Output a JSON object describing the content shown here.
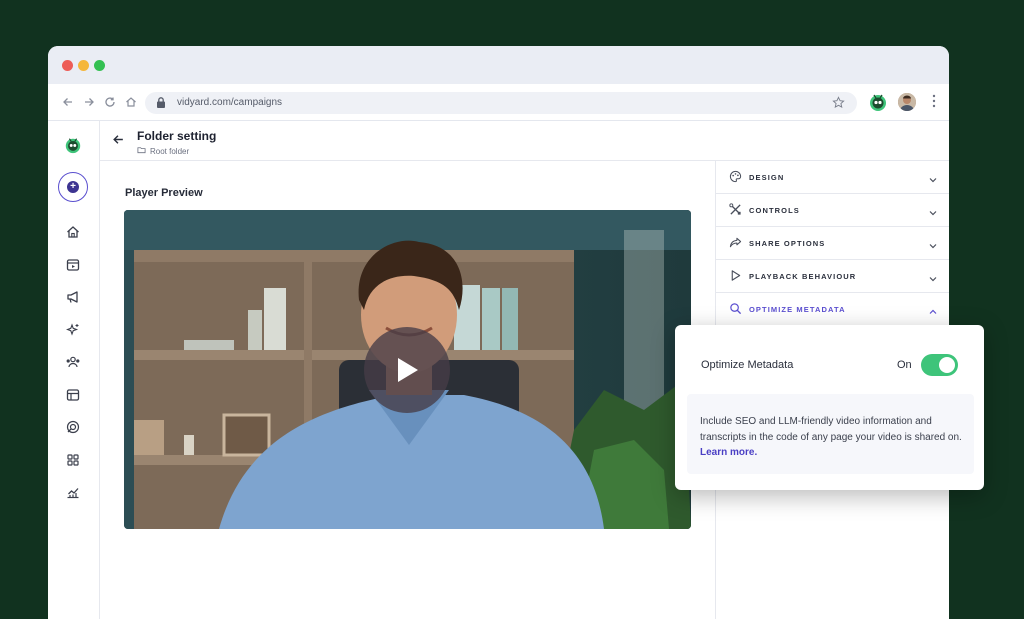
{
  "browser": {
    "url": "vidyard.com/campaigns"
  },
  "header": {
    "title": "Folder setting",
    "breadcrumb": "Root folder"
  },
  "main": {
    "preview_label": "Player Preview"
  },
  "settings": {
    "items": [
      {
        "label": "DESIGN",
        "icon": "palette-icon"
      },
      {
        "label": "CONTROLS",
        "icon": "tools-icon"
      },
      {
        "label": "SHARE OPTIONS",
        "icon": "share-icon"
      },
      {
        "label": "PLAYBACK BEHAVIOUR",
        "icon": "play-outline-icon"
      },
      {
        "label": "OPTIMIZE METADATA",
        "icon": "search-icon"
      }
    ]
  },
  "popover": {
    "title": "Optimize Metadata",
    "toggle_label": "On",
    "description": "Include SEO and LLM-friendly video information and transcripts in the code of any page your video is shared on.",
    "link": "Learn more."
  },
  "colors": {
    "background": "#11321f",
    "accent": "#5b4fd0",
    "toggle_on": "#3ec47a"
  }
}
